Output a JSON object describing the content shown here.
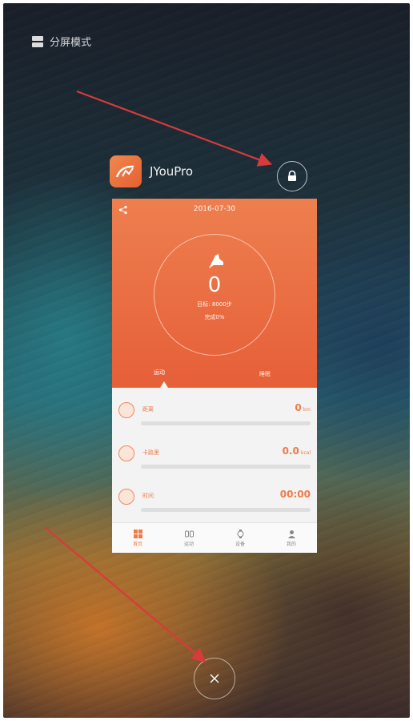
{
  "top_bar": {
    "split_mode_label": "分屏模式"
  },
  "app": {
    "name": "JYouPro"
  },
  "card": {
    "date": "2016-07-30",
    "steps": "0",
    "goal_text": "目标: 8000步",
    "goal_sub": "完成0%",
    "tabs": [
      "运动",
      "睡眠"
    ],
    "stats": [
      {
        "label": "距离",
        "value": "0",
        "unit": "km"
      },
      {
        "label": "卡路里",
        "value": "0.0",
        "unit": "kcal"
      },
      {
        "label": "时间",
        "value": "00:00",
        "unit": ""
      }
    ],
    "nav": [
      "首页",
      "运动",
      "设备",
      "我的"
    ]
  },
  "colors": {
    "accent": "#ef7b4b",
    "arrow": "#d93a3a"
  }
}
